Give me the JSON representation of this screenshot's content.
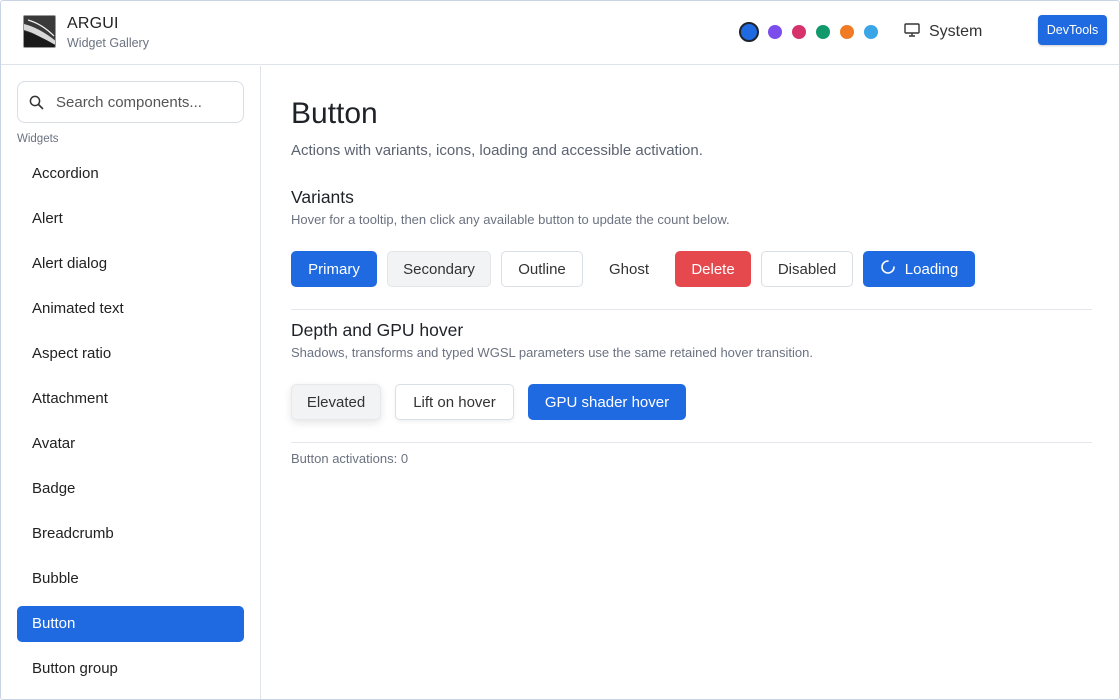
{
  "header": {
    "app_title": "ARGUI",
    "app_subtitle": "Widget Gallery",
    "theme_swatches": [
      {
        "name": "blue",
        "color": "#1f6ae0",
        "active": true
      },
      {
        "name": "purple",
        "color": "#7c4ded"
      },
      {
        "name": "pink",
        "color": "#d6336c"
      },
      {
        "name": "green",
        "color": "#12996b"
      },
      {
        "name": "orange",
        "color": "#f07b24"
      },
      {
        "name": "sky",
        "color": "#3aa6e8"
      }
    ],
    "theme_mode_label": "System",
    "theme_mode_icon": "monitor-icon",
    "devtools_label": "DevTools"
  },
  "sidebar": {
    "search_placeholder": "Search components...",
    "section_label": "Widgets",
    "items": [
      {
        "label": "Accordion"
      },
      {
        "label": "Alert"
      },
      {
        "label": "Alert dialog"
      },
      {
        "label": "Animated text"
      },
      {
        "label": "Aspect ratio"
      },
      {
        "label": "Attachment"
      },
      {
        "label": "Avatar"
      },
      {
        "label": "Badge"
      },
      {
        "label": "Breadcrumb"
      },
      {
        "label": "Bubble"
      },
      {
        "label": "Button",
        "active": true
      },
      {
        "label": "Button group"
      }
    ]
  },
  "main": {
    "title": "Button",
    "description": "Actions with variants, icons, loading and accessible activation.",
    "variants": {
      "title": "Variants",
      "description": "Hover for a tooltip, then click any available button to update the count below.",
      "buttons": {
        "primary": "Primary",
        "secondary": "Secondary",
        "outline": "Outline",
        "ghost": "Ghost",
        "delete": "Delete",
        "disabled": "Disabled",
        "loading": "Loading"
      }
    },
    "depth": {
      "title": "Depth and GPU hover",
      "description": "Shadows, transforms and typed WGSL parameters use the same retained hover transition.",
      "buttons": {
        "elevated": "Elevated",
        "lift": "Lift on hover",
        "gpu": "GPU shader hover"
      }
    },
    "activations_text": "Button activations: 0"
  },
  "colors": {
    "accent": "#1f6ae0",
    "danger": "#e5484d"
  }
}
